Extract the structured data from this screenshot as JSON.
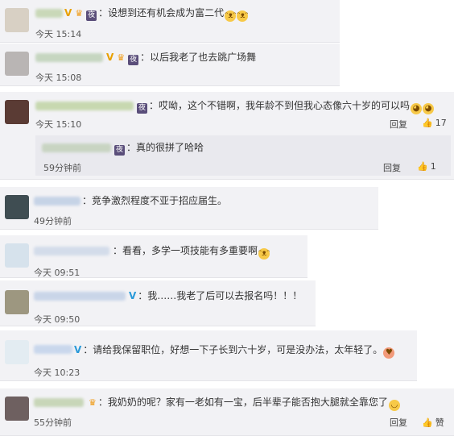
{
  "comments": [
    {
      "text": "：设想到还有机会成为富二代",
      "time": "今天 15:14"
    },
    {
      "text": "：以后我老了也去跳广场舞",
      "time": "今天 15:08"
    },
    {
      "text": "：哎呦，这个不错啊，我年龄不到但我心态像六十岁的可以吗",
      "time": "今天 15:10",
      "reply": "回复",
      "likes": "17",
      "sub": {
        "text": "：真的很拼了哈哈",
        "time": "59分钟前",
        "reply": "回复",
        "likes": "1"
      }
    },
    {
      "text": "：竞争激烈程度不亚于招应届生。",
      "time": "49分钟前"
    },
    {
      "text": "：看看，多学一项技能有多重要啊",
      "time": "今天 09:51"
    },
    {
      "text": "：我……我老了后可以去报名吗！！！",
      "time": "今天 09:50"
    },
    {
      "text": "：请给我保留职位，好想一下子长到六十岁，可是没办法，太年轻了。",
      "time": "今天 10:23"
    },
    {
      "text": "：我奶奶的呢？家有一老如有一宝，后半辈子能否抱大腿就全靠您了",
      "time": "55分钟前",
      "reply": "回复",
      "likes": "赞"
    }
  ],
  "icons": {
    "vip": "V",
    "night_badge": "夜",
    "thumb": "👍"
  }
}
